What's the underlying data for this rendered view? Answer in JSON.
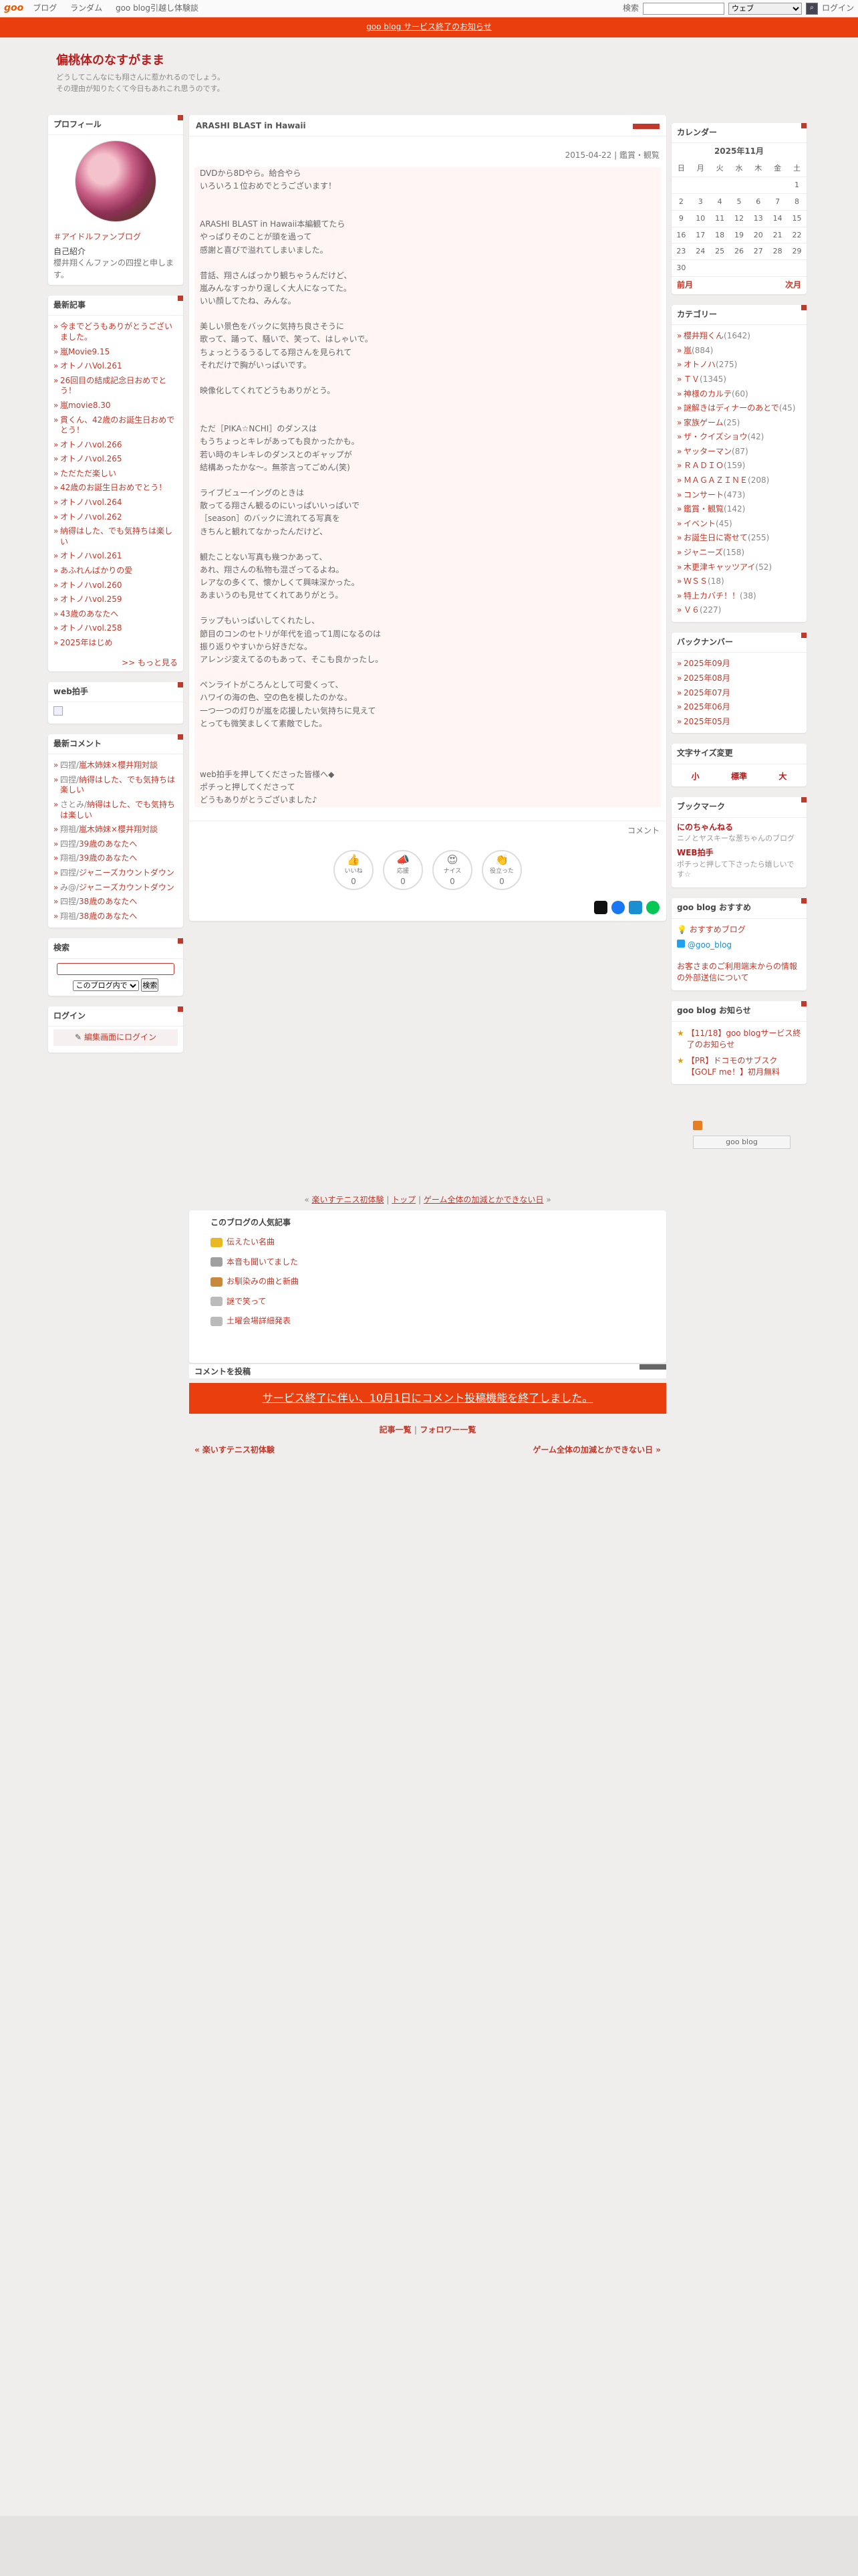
{
  "topbar": {
    "logo": "goo",
    "nav": [
      "ブログ",
      "ランダム",
      "goo blog引越し体験談"
    ],
    "search_label": "検索",
    "search_scope": "ウェブ",
    "login": "ログイン"
  },
  "notice": "goo blog サービス終了のお知らせ",
  "blog": {
    "title": "偏桃体のなすがまま",
    "desc1": "どうしてこんなにも翔さんに惹かれるのでしょう。",
    "desc2": "その理由が知りたくて今日もあれこれ思うのです。"
  },
  "profile": {
    "title": "プロフィール",
    "tag": "＃アイドルファンブログ",
    "intro_h": "自己紹介",
    "intro": "櫻井翔くんファンの四捏と申します。"
  },
  "recent": {
    "title": "最新記事",
    "items": [
      "今までどうもありがとうございました。",
      "嵐Movie9.15",
      "オトノハVol.261",
      "26回目の結成記念日おめでとう！",
      "嵐movie8.30",
      "貫くん、42歳のお誕生日おめでとう！",
      "オトノハvol.266",
      "オトノハvol.265",
      "ただただ楽しい",
      "42歳のお誕生日おめでとう！",
      "オトノハvol.264",
      "オトノハvol.262",
      "納得はした、でも気持ちは楽しい",
      "オトノハvol.261",
      "あふれんばかりの愛",
      "オトノハvol.260",
      "オトノハvol.259",
      "43歳のあなたへ",
      "オトノハvol.258",
      "2025年はじめ"
    ],
    "more": ">> もっと見る"
  },
  "web": {
    "title": "web拍手"
  },
  "comments": {
    "title": "最新コメント",
    "items": [
      {
        "a": "四捏/",
        "b": "嵐木姉妹×櫻井翔対談"
      },
      {
        "a": "四捏/",
        "b": "納得はした、でも気持ちは楽しい"
      },
      {
        "a": "さとみ/",
        "b": "納得はした、でも気持ちは楽しい"
      },
      {
        "a": "翔祖/",
        "b": "嵐木姉妹×櫻井翔対談"
      },
      {
        "a": "四捏/",
        "b": "39歳のあなたへ"
      },
      {
        "a": "翔祖/",
        "b": "39歳のあなたへ"
      },
      {
        "a": "四捏/",
        "b": "ジャニーズカウントダウン"
      },
      {
        "a": "み@/",
        "b": "ジャニーズカウントダウン"
      },
      {
        "a": "四捏/",
        "b": "38歳のあなたへ"
      },
      {
        "a": "翔祖/",
        "b": "38歳のあなたへ"
      }
    ]
  },
  "search": {
    "title": "検索",
    "scope": "このブログ内で",
    "button": "検索"
  },
  "login": {
    "title": "ログイン",
    "link": "編集画面にログイン"
  },
  "entry": {
    "title": "ARASHI BLAST in Hawaii",
    "date": "2015-04-22",
    "category": "鑑賞・観覧",
    "lines": [
      "DVDから8Dやら。給合やら",
      "いろいろ１位おめでとうございます！",
      "",
      "",
      "ARASHI BLAST in Hawaii本編観てたら",
      "やっぱりそのことが頭を過って",
      "感謝と喜びで溢れてしまいました。",
      "",
      "昔話、翔さんばっかり観ちゃうんだけど、",
      "嵐みんなすっかり逞しく大人になってた。",
      "いい顔してたね、みんな。",
      "",
      "美しい景色をバックに気持ち良さそうに",
      "歌って、踊って、騒いで、笑って、はしゃいで。",
      "ちょっとうるうるしてる翔さんを見られて",
      "それだけで胸がいっぱいです。",
      "",
      "映像化してくれてどうもありがとう。",
      "",
      "",
      "ただ［PIKA☆NCHI］のダンスは",
      "もうちょっとキレがあっても良かったかも。",
      "若い時のキレキレのダンスとのギャップが",
      "結構あったかな～。無茶言ってごめん(笑)",
      "",
      "ライブビューイングのときは",
      "散ってる翔さん観るのにいっぱいいっぱいで",
      "［season］のバックに流れてる写真を",
      "きちんと観れてなかったんだけど、",
      "",
      "観たことない写真も幾つかあって、",
      "あれ、翔さんの私物も混ざってるよね。",
      "レアなの多くて、懐かしくて興味深かった。",
      "あまいうのも見せてくれてありがとう。",
      "",
      "ラップもいっぱいしてくれたし、",
      "節目のコンのセトリが年代を追って1周になるのは",
      "振り返りやすいから好きだな。",
      "アレンジ変えてるのもあって、そこも良かったし。",
      "",
      "ペンライトがころんとして可愛くって、",
      "ハワイの海の色、空の色を模したのかな。",
      "一つ一つの灯りが嵐を応援したい気持ちに見えて",
      "とっても微笑ましくて素敵でした。",
      "",
      "",
      "",
      "web拍手を押してくださった皆様へ◆",
      "ポチっと押してくださって",
      "どうもありがとうございました♪"
    ],
    "comment_link": "コメント",
    "reactions": [
      {
        "l": "いいね",
        "c": "0"
      },
      {
        "l": "応援",
        "c": "0"
      },
      {
        "l": "ナイス",
        "c": "0"
      },
      {
        "l": "役立った",
        "c": "0"
      }
    ]
  },
  "calendar": {
    "title": "カレンダー",
    "month": "2025年11月",
    "dows": [
      "日",
      "月",
      "火",
      "水",
      "木",
      "金",
      "土"
    ],
    "weeks": [
      [
        "",
        "",
        "",
        "",
        "",
        "",
        "1"
      ],
      [
        "2",
        "3",
        "4",
        "5",
        "6",
        "7",
        "8"
      ],
      [
        "9",
        "10",
        "11",
        "12",
        "13",
        "14",
        "15"
      ],
      [
        "16",
        "17",
        "18",
        "19",
        "20",
        "21",
        "22"
      ],
      [
        "23",
        "24",
        "25",
        "26",
        "27",
        "28",
        "29"
      ],
      [
        "30",
        "",
        "",
        "",
        "",
        "",
        ""
      ]
    ],
    "prev": "前月",
    "next": "次月"
  },
  "categories": {
    "title": "カテゴリー",
    "items": [
      {
        "n": "櫻井翔くん",
        "c": "(1642)"
      },
      {
        "n": "嵐",
        "c": "(884)"
      },
      {
        "n": "オトノハ",
        "c": "(275)"
      },
      {
        "n": "ＴＶ",
        "c": "(1345)"
      },
      {
        "n": "神様のカルテ",
        "c": "(60)"
      },
      {
        "n": "謎解きはディナーのあとで",
        "c": "(45)"
      },
      {
        "n": "家族ゲーム",
        "c": "(25)"
      },
      {
        "n": "ザ・クイズショウ",
        "c": "(42)"
      },
      {
        "n": "ヤッターマン",
        "c": "(87)"
      },
      {
        "n": "ＲＡＤＩＯ",
        "c": "(159)"
      },
      {
        "n": "ＭＡＧＡＺＩＮＥ",
        "c": "(208)"
      },
      {
        "n": "コンサート",
        "c": "(473)"
      },
      {
        "n": "鑑賞・観覧",
        "c": "(142)"
      },
      {
        "n": "イベント",
        "c": "(45)"
      },
      {
        "n": "お誕生日に寄せて",
        "c": "(255)"
      },
      {
        "n": "ジャニーズ",
        "c": "(158)"
      },
      {
        "n": "木更津キャッツアイ",
        "c": "(52)"
      },
      {
        "n": "ＷＳＳ",
        "c": "(18)"
      },
      {
        "n": "特上カバチ！！",
        "c": "(38)"
      },
      {
        "n": "Ｖ６",
        "c": "(227)"
      }
    ]
  },
  "backnumber": {
    "title": "バックナンバー",
    "items": [
      "2025年09月",
      "2025年08月",
      "2025年07月",
      "2025年06月",
      "2025年05月"
    ]
  },
  "fontsize": {
    "title": "文字サイズ変更",
    "small": "小",
    "mid": "標準",
    "large": "大"
  },
  "bookmark": {
    "title": "ブックマーク",
    "items": [
      {
        "n": "にのちゃんねる",
        "d": "ニノとヤスキーな葱ちゃんのブログ"
      },
      {
        "n": "WEB拍手",
        "d": "ポチっと押して下さったら嬉しいです☆"
      }
    ]
  },
  "gooreco": {
    "title": "goo blog おすすめ",
    "a": "おすすめブログ",
    "b": "@goo_blog",
    "c": "お客さまのご利用端末からの情報の外部送信について"
  },
  "goonews": {
    "title": "goo blog お知らせ",
    "items": [
      "【11/18】goo blogサービス終了のお知らせ",
      "【PR】ドコモのサブスク【GOLF me！】初月無料"
    ]
  },
  "gooblog_badge": "goo blog",
  "pager": {
    "prev": "楽いすテニス初体験",
    "top": "トップ",
    "next": "ゲーム全体の加減とかできない日"
  },
  "popular": {
    "title": "このブログの人気記事",
    "items": [
      "伝えたい名曲",
      "本音も聞いてました",
      "お馴染みの曲と新曲",
      "謎で笑って",
      "土曜会場詳細発表"
    ]
  },
  "comment_form": {
    "title": "コメントを投稿",
    "notice": "サービス終了に伴い、10月1日にコメント投稿機能を終了しました。"
  },
  "foot_links": {
    "list": "記事一覧",
    "sep": "|",
    "follow": "フォロワー一覧",
    "prev": "« 楽いすテニス初体験",
    "next": "ゲーム全体の加減とかできない日 »"
  },
  "colors": {
    "accent": "#c0392b",
    "notice": "#ea3e0e"
  }
}
